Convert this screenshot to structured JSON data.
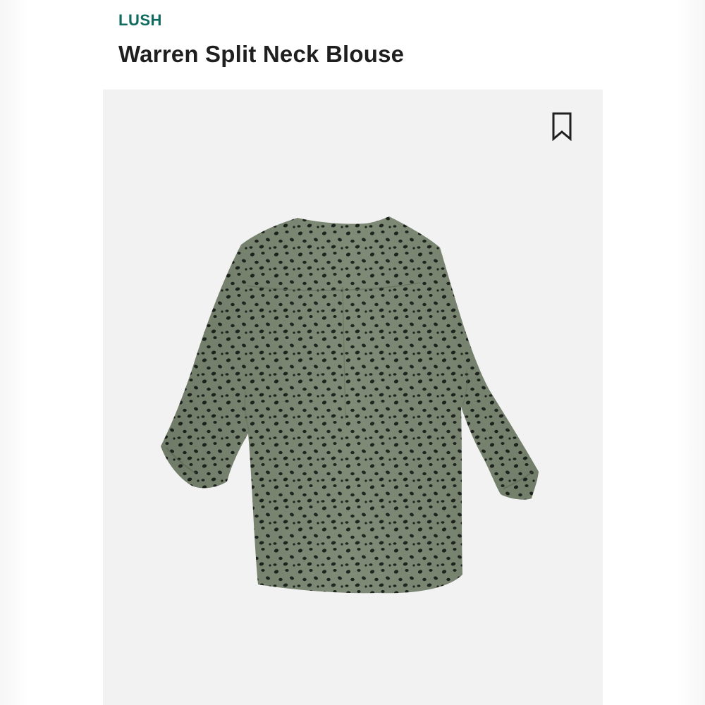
{
  "product": {
    "brand": "LUSH",
    "name": "Warren Split Neck Blouse"
  },
  "icons": {
    "bookmark": "bookmark-icon"
  },
  "colors": {
    "brand": "#0f6b5f",
    "title": "#1f1f1f",
    "image_background": "#f2f2f3",
    "fabric": "#7f8b76",
    "spots": "#1f241e"
  }
}
